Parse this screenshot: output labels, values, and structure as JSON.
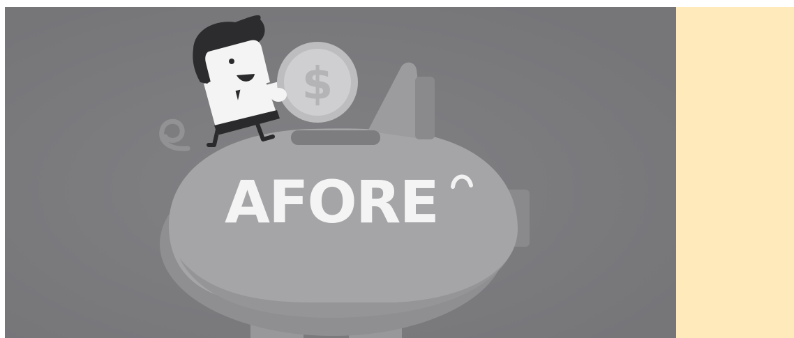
{
  "illustration": {
    "label": "AFORE",
    "coin_symbol": "$",
    "icons": [
      "piggy-bank-icon",
      "businessman-icon",
      "coin-icon"
    ]
  },
  "colors": {
    "background": "#7c7c7f",
    "piggy": "#a3a3a5",
    "piggy_shadow": "#8d8d90",
    "coin": "#c9c9cb",
    "text": "#f4f4f4",
    "side_panel": "#ffeabb"
  }
}
